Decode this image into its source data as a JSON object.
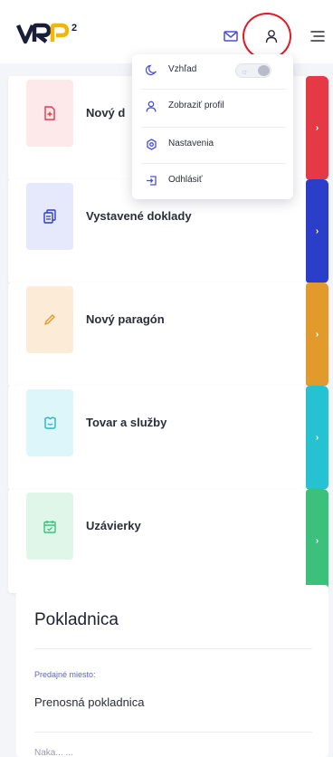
{
  "header": {
    "logo_text": "VRP",
    "logo_superscript": "2",
    "icons": [
      "mail-icon",
      "user-icon",
      "menu-icon"
    ]
  },
  "menu": {
    "items": [
      {
        "label": "Vzhľad",
        "icon": "moon-icon"
      },
      {
        "label": "Zobraziť profil",
        "icon": "user-icon"
      },
      {
        "label": "Nastavenia",
        "icon": "gear-icon"
      },
      {
        "label": "Odhlásiť",
        "icon": "logout-icon"
      }
    ],
    "theme_toggle_on": false
  },
  "cards": [
    {
      "label": "Nový d",
      "icon": "doc-plus-icon",
      "color": "#e63946"
    },
    {
      "label": "Vystavené doklady",
      "icon": "copy-icon",
      "color": "#2b3ec9"
    },
    {
      "label": "Nový paragón",
      "icon": "pencil-icon",
      "color": "#e39a2d"
    },
    {
      "label": "Tovar a služby",
      "icon": "box-icon",
      "color": "#26c2d2"
    },
    {
      "label": "Uzávierky",
      "icon": "calendar-icon",
      "color": "#3cc17c"
    }
  ],
  "card_arrow": "›",
  "register": {
    "title": "Pokladnica",
    "field_label": "Predajné miesto:",
    "field_value": "Prenosná pokladnica",
    "next_label_partial": "Naka... ..."
  },
  "colors": {
    "accent": "#5b5fe0",
    "highlight": "#e01b24"
  }
}
